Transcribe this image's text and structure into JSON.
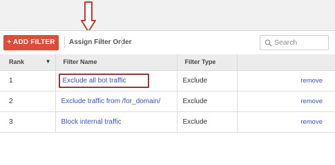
{
  "toolbar": {
    "add_filter_label": "+ ADD FILTER",
    "assign_order_label": "Assign Filter Order",
    "search_placeholder": "Search"
  },
  "table": {
    "columns": [
      "Rank",
      "Filter Name",
      "Filter Type",
      ""
    ],
    "rows": [
      {
        "rank": "1",
        "name": "Exclude all bot traffic",
        "type": "Exclude",
        "action": "remove"
      },
      {
        "rank": "2",
        "name": "Exclude traffic from /for_domain/",
        "type": "Exclude",
        "action": "remove"
      },
      {
        "rank": "3",
        "name": "Block internal traffic",
        "type": "Exclude",
        "action": "remove"
      }
    ]
  },
  "colors": {
    "accent_button": "#de4d3a",
    "link": "#3f51b5",
    "annotation": "#c0392b"
  },
  "icons": [
    "down-arrow-annotation-icon",
    "search-icon",
    "sort-down-icon"
  ]
}
